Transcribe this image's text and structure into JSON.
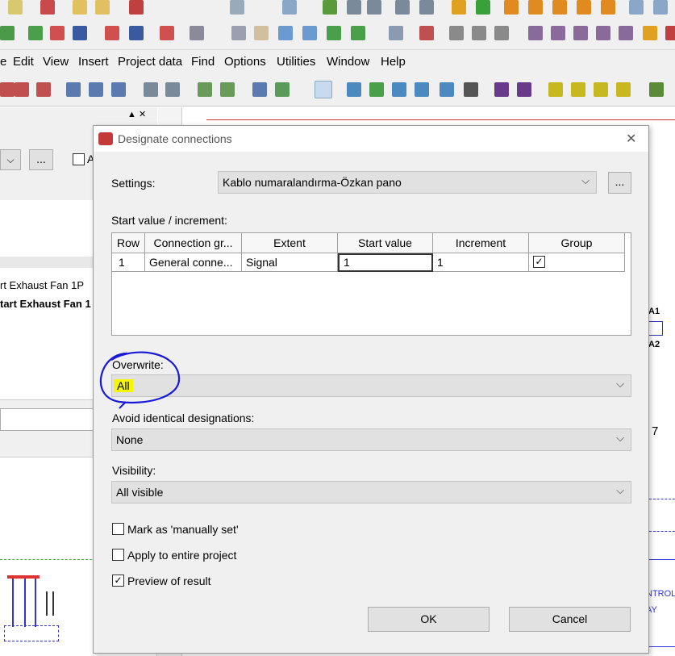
{
  "menubar": {
    "items": [
      {
        "label": "e"
      },
      {
        "label": "Edit"
      },
      {
        "label": "View"
      },
      {
        "label": "Insert"
      },
      {
        "label": "Project data"
      },
      {
        "label": "Find"
      },
      {
        "label": "Options"
      },
      {
        "label": "Utilities"
      },
      {
        "label": "Window"
      },
      {
        "label": "Help"
      }
    ]
  },
  "background": {
    "panel_close": "▲ ✕",
    "panel_more": "...",
    "panel_check_label": "A",
    "list_items": [
      "rt Exhaust Fan 1P",
      "tart Exhaust Fan 1"
    ],
    "schematic_labels": [
      "A1",
      "A2",
      "7",
      "NTROL",
      "AY"
    ]
  },
  "dialog": {
    "title": "Designate connections",
    "close": "✕",
    "settings_label": "Settings:",
    "settings_value": "Kablo numaralandırma-Özkan pano",
    "settings_more": "...",
    "start_label": "Start value / increment:",
    "table": {
      "headers": [
        "Row",
        "Connection gr...",
        "Extent",
        "Start value",
        "Increment",
        "Group"
      ],
      "rows": [
        {
          "row": "1",
          "connection_group": "General conne...",
          "extent": "Signal",
          "start_value": "1",
          "increment": "1",
          "group_checked": true
        }
      ]
    },
    "overwrite_label": "Overwrite:",
    "overwrite_value": "All",
    "avoid_label": "Avoid identical designations:",
    "avoid_value": "None",
    "visibility_label": "Visibility:",
    "visibility_value": "All visible",
    "checkboxes": [
      {
        "label": "Mark as 'manually set'",
        "checked": false
      },
      {
        "label": "Apply to entire project",
        "checked": false
      },
      {
        "label": "Preview of result",
        "checked": true
      }
    ],
    "ok_label": "OK",
    "cancel_label": "Cancel"
  },
  "colors": {
    "highlight": "#f5f50a",
    "annotation": "#1a1ad6"
  }
}
